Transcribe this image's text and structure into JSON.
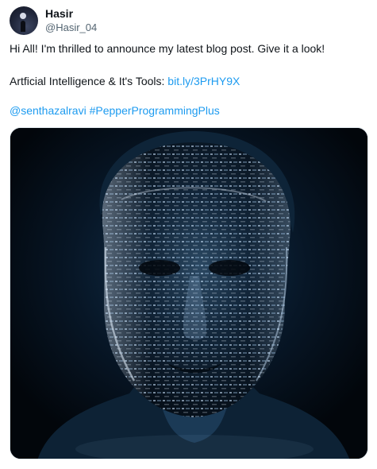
{
  "author": {
    "display_name": "Hasir",
    "handle": "@Hasir_04",
    "avatar_icon": "avatar-icon"
  },
  "tweet": {
    "line1": "Hi All! I'm thrilled to announce my latest blog post. Give it a look!",
    "line2_prefix": "Artficial Intelligence & It's Tools:",
    "line2_link": "bit.ly/3PrHY9X",
    "mention": "@senthazalravi",
    "hashtag": "#PepperProgrammingPlus"
  },
  "media": {
    "kind": "ai-face-code-illustration",
    "background_color": "#04080e",
    "glow_color": "#9fc4e6"
  },
  "colors": {
    "link": "#1d9bf0",
    "text": "#0f1419",
    "muted": "#536471"
  }
}
